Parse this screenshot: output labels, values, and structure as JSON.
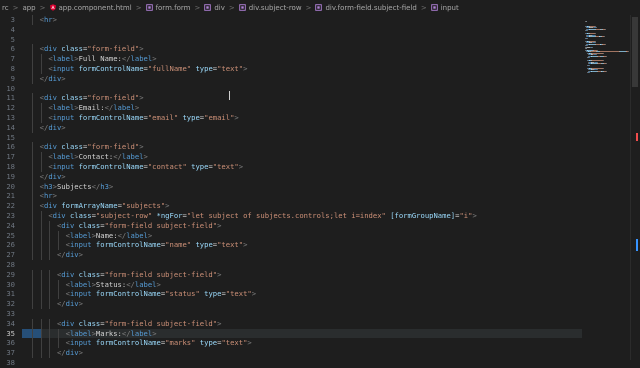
{
  "breadcrumb": {
    "items": [
      {
        "label": "rc",
        "icon": ""
      },
      {
        "label": "app",
        "icon": ""
      },
      {
        "label": "app.component.html",
        "icon": "angular-icon"
      },
      {
        "label": "form.form",
        "icon": "element-icon"
      },
      {
        "label": "div",
        "icon": "element-icon"
      },
      {
        "label": "div.subject-row",
        "icon": "element-icon"
      },
      {
        "label": "div.form-field.subject-field",
        "icon": "element-icon"
      },
      {
        "label": "input",
        "icon": "element-icon"
      }
    ],
    "separator": ">"
  },
  "editor": {
    "first_line_number": 3,
    "active_line": 35,
    "lines": [
      {
        "n": 3,
        "indent": 2,
        "tokens": [
          [
            "pun",
            "<"
          ],
          [
            "tag",
            "hr"
          ],
          [
            "pun",
            ">"
          ]
        ]
      },
      {
        "n": 4,
        "indent": 0,
        "tokens": []
      },
      {
        "n": 5,
        "indent": 0,
        "tokens": []
      },
      {
        "n": 6,
        "indent": 2,
        "tokens": [
          [
            "pun",
            "<"
          ],
          [
            "tag",
            "div"
          ],
          [
            "txt",
            " "
          ],
          [
            "attr",
            "class"
          ],
          [
            "txt",
            "="
          ],
          [
            "str",
            "\"form-field\""
          ],
          [
            "pun",
            ">"
          ]
        ]
      },
      {
        "n": 7,
        "indent": 4,
        "tokens": [
          [
            "pun",
            "<"
          ],
          [
            "tag",
            "label"
          ],
          [
            "pun",
            ">"
          ],
          [
            "txt",
            "Full Name:"
          ],
          [
            "pun",
            "</"
          ],
          [
            "tag",
            "label"
          ],
          [
            "pun",
            ">"
          ]
        ]
      },
      {
        "n": 8,
        "indent": 4,
        "tokens": [
          [
            "pun",
            "<"
          ],
          [
            "tag",
            "input"
          ],
          [
            "txt",
            " "
          ],
          [
            "attr",
            "formControlName"
          ],
          [
            "txt",
            "="
          ],
          [
            "str",
            "\"fullName\""
          ],
          [
            "txt",
            " "
          ],
          [
            "attr",
            "type"
          ],
          [
            "txt",
            "="
          ],
          [
            "str",
            "\"text\""
          ],
          [
            "pun",
            ">"
          ]
        ]
      },
      {
        "n": 9,
        "indent": 2,
        "tokens": [
          [
            "pun",
            "</"
          ],
          [
            "tag",
            "div"
          ],
          [
            "pun",
            ">"
          ]
        ]
      },
      {
        "n": 10,
        "indent": 0,
        "tokens": []
      },
      {
        "n": 11,
        "indent": 2,
        "tokens": [
          [
            "pun",
            "<"
          ],
          [
            "tag",
            "div"
          ],
          [
            "txt",
            " "
          ],
          [
            "attr",
            "class"
          ],
          [
            "txt",
            "="
          ],
          [
            "str",
            "\"form-field\""
          ],
          [
            "pun",
            ">"
          ]
        ]
      },
      {
        "n": 12,
        "indent": 4,
        "tokens": [
          [
            "pun",
            "<"
          ],
          [
            "tag",
            "label"
          ],
          [
            "pun",
            ">"
          ],
          [
            "txt",
            "Email:"
          ],
          [
            "pun",
            "</"
          ],
          [
            "tag",
            "label"
          ],
          [
            "pun",
            ">"
          ]
        ]
      },
      {
        "n": 13,
        "indent": 4,
        "tokens": [
          [
            "pun",
            "<"
          ],
          [
            "tag",
            "input"
          ],
          [
            "txt",
            " "
          ],
          [
            "attr",
            "formControlName"
          ],
          [
            "txt",
            "="
          ],
          [
            "str",
            "\"email\""
          ],
          [
            "txt",
            " "
          ],
          [
            "attr",
            "type"
          ],
          [
            "txt",
            "="
          ],
          [
            "str",
            "\"email\""
          ],
          [
            "pun",
            ">"
          ]
        ]
      },
      {
        "n": 14,
        "indent": 2,
        "tokens": [
          [
            "pun",
            "</"
          ],
          [
            "tag",
            "div"
          ],
          [
            "pun",
            ">"
          ]
        ]
      },
      {
        "n": 15,
        "indent": 0,
        "tokens": []
      },
      {
        "n": 16,
        "indent": 2,
        "tokens": [
          [
            "pun",
            "<"
          ],
          [
            "tag",
            "div"
          ],
          [
            "txt",
            " "
          ],
          [
            "attr",
            "class"
          ],
          [
            "txt",
            "="
          ],
          [
            "str",
            "\"form-field\""
          ],
          [
            "pun",
            ">"
          ]
        ]
      },
      {
        "n": 17,
        "indent": 4,
        "tokens": [
          [
            "pun",
            "<"
          ],
          [
            "tag",
            "label"
          ],
          [
            "pun",
            ">"
          ],
          [
            "txt",
            "Contact:"
          ],
          [
            "pun",
            "</"
          ],
          [
            "tag",
            "label"
          ],
          [
            "pun",
            ">"
          ]
        ]
      },
      {
        "n": 18,
        "indent": 4,
        "tokens": [
          [
            "pun",
            "<"
          ],
          [
            "tag",
            "input"
          ],
          [
            "txt",
            " "
          ],
          [
            "attr",
            "formControlName"
          ],
          [
            "txt",
            "="
          ],
          [
            "str",
            "\"contact\""
          ],
          [
            "txt",
            " "
          ],
          [
            "attr",
            "type"
          ],
          [
            "txt",
            "="
          ],
          [
            "str",
            "\"text\""
          ],
          [
            "pun",
            ">"
          ]
        ]
      },
      {
        "n": 19,
        "indent": 2,
        "tokens": [
          [
            "pun",
            "</"
          ],
          [
            "tag",
            "div"
          ],
          [
            "pun",
            ">"
          ]
        ]
      },
      {
        "n": 20,
        "indent": 2,
        "tokens": [
          [
            "pun",
            "<"
          ],
          [
            "tag",
            "h3"
          ],
          [
            "pun",
            ">"
          ],
          [
            "txt",
            "Subjects"
          ],
          [
            "pun",
            "</"
          ],
          [
            "tag",
            "h3"
          ],
          [
            "pun",
            ">"
          ]
        ]
      },
      {
        "n": 21,
        "indent": 2,
        "tokens": [
          [
            "pun",
            "<"
          ],
          [
            "tag",
            "hr"
          ],
          [
            "pun",
            ">"
          ]
        ]
      },
      {
        "n": 22,
        "indent": 2,
        "tokens": [
          [
            "pun",
            "<"
          ],
          [
            "tag",
            "div"
          ],
          [
            "txt",
            " "
          ],
          [
            "attr",
            "formArrayName"
          ],
          [
            "txt",
            "="
          ],
          [
            "str",
            "\"subjects\""
          ],
          [
            "pun",
            ">"
          ]
        ]
      },
      {
        "n": 23,
        "indent": 4,
        "tokens": [
          [
            "pun",
            "<"
          ],
          [
            "tag",
            "div"
          ],
          [
            "txt",
            " "
          ],
          [
            "attr",
            "class"
          ],
          [
            "txt",
            "="
          ],
          [
            "str",
            "\"subject-row\""
          ],
          [
            "txt",
            " "
          ],
          [
            "attr",
            "*ngFor"
          ],
          [
            "txt",
            "="
          ],
          [
            "str",
            "\"let subject of subjects.controls;let i=index\""
          ],
          [
            "txt",
            " "
          ],
          [
            "attr",
            "[formGroupName]"
          ],
          [
            "txt",
            "="
          ],
          [
            "str",
            "\"i\""
          ],
          [
            "pun",
            ">"
          ]
        ]
      },
      {
        "n": 24,
        "indent": 6,
        "tokens": [
          [
            "pun",
            "<"
          ],
          [
            "tag",
            "div"
          ],
          [
            "txt",
            " "
          ],
          [
            "attr",
            "class"
          ],
          [
            "txt",
            "="
          ],
          [
            "str",
            "\"form-field subject-field\""
          ],
          [
            "pun",
            ">"
          ]
        ]
      },
      {
        "n": 25,
        "indent": 8,
        "tokens": [
          [
            "pun",
            "<"
          ],
          [
            "tag",
            "label"
          ],
          [
            "pun",
            ">"
          ],
          [
            "txt",
            "Name:"
          ],
          [
            "pun",
            "</"
          ],
          [
            "tag",
            "label"
          ],
          [
            "pun",
            ">"
          ]
        ]
      },
      {
        "n": 26,
        "indent": 8,
        "tokens": [
          [
            "pun",
            "<"
          ],
          [
            "tag",
            "input"
          ],
          [
            "txt",
            " "
          ],
          [
            "attr",
            "formControlName"
          ],
          [
            "txt",
            "="
          ],
          [
            "str",
            "\"name\""
          ],
          [
            "txt",
            " "
          ],
          [
            "attr",
            "type"
          ],
          [
            "txt",
            "="
          ],
          [
            "str",
            "\"text\""
          ],
          [
            "pun",
            ">"
          ]
        ]
      },
      {
        "n": 27,
        "indent": 6,
        "tokens": [
          [
            "pun",
            "</"
          ],
          [
            "tag",
            "div"
          ],
          [
            "pun",
            ">"
          ]
        ]
      },
      {
        "n": 28,
        "indent": 0,
        "tokens": []
      },
      {
        "n": 29,
        "indent": 6,
        "tokens": [
          [
            "pun",
            "<"
          ],
          [
            "tag",
            "div"
          ],
          [
            "txt",
            " "
          ],
          [
            "attr",
            "class"
          ],
          [
            "txt",
            "="
          ],
          [
            "str",
            "\"form-field subject-field\""
          ],
          [
            "pun",
            ">"
          ]
        ]
      },
      {
        "n": 30,
        "indent": 8,
        "tokens": [
          [
            "pun",
            "<"
          ],
          [
            "tag",
            "label"
          ],
          [
            "pun",
            ">"
          ],
          [
            "txt",
            "Status:"
          ],
          [
            "pun",
            "</"
          ],
          [
            "tag",
            "label"
          ],
          [
            "pun",
            ">"
          ]
        ]
      },
      {
        "n": 31,
        "indent": 8,
        "tokens": [
          [
            "pun",
            "<"
          ],
          [
            "tag",
            "input"
          ],
          [
            "txt",
            " "
          ],
          [
            "attr",
            "formControlName"
          ],
          [
            "txt",
            "="
          ],
          [
            "str",
            "\"status\""
          ],
          [
            "txt",
            " "
          ],
          [
            "attr",
            "type"
          ],
          [
            "txt",
            "="
          ],
          [
            "str",
            "\"text\""
          ],
          [
            "pun",
            ">"
          ]
        ]
      },
      {
        "n": 32,
        "indent": 6,
        "tokens": [
          [
            "pun",
            "</"
          ],
          [
            "tag",
            "div"
          ],
          [
            "pun",
            ">"
          ]
        ]
      },
      {
        "n": 33,
        "indent": 0,
        "tokens": []
      },
      {
        "n": 34,
        "indent": 6,
        "tokens": [
          [
            "pun",
            "<"
          ],
          [
            "tag",
            "div"
          ],
          [
            "txt",
            " "
          ],
          [
            "attr",
            "class"
          ],
          [
            "txt",
            "="
          ],
          [
            "str",
            "\"form-field subject-field\""
          ],
          [
            "pun",
            ">"
          ]
        ]
      },
      {
        "n": 35,
        "indent": 8,
        "tokens": [
          [
            "pun",
            "<"
          ],
          [
            "tag",
            "label"
          ],
          [
            "pun",
            ">"
          ],
          [
            "txt",
            "Marks:"
          ],
          [
            "pun",
            "</"
          ],
          [
            "tag",
            "label"
          ],
          [
            "pun",
            ">"
          ]
        ]
      },
      {
        "n": 36,
        "indent": 8,
        "tokens": [
          [
            "pun",
            "<"
          ],
          [
            "tag",
            "input"
          ],
          [
            "txt",
            " "
          ],
          [
            "attr",
            "formControlName"
          ],
          [
            "txt",
            "="
          ],
          [
            "str",
            "\"marks\""
          ],
          [
            "txt",
            " "
          ],
          [
            "attr",
            "type"
          ],
          [
            "txt",
            "="
          ],
          [
            "str",
            "\"text\""
          ],
          [
            "pun",
            ">"
          ]
        ]
      },
      {
        "n": 37,
        "indent": 6,
        "tokens": [
          [
            "pun",
            "</"
          ],
          [
            "tag",
            "div"
          ],
          [
            "pun",
            ">"
          ]
        ]
      },
      {
        "n": 38,
        "indent": 0,
        "tokens": []
      }
    ]
  },
  "colors": {
    "background": "#1e1e1e",
    "tag": "#569cd6",
    "attribute": "#9cdcfe",
    "string": "#ce9178",
    "punctuation": "#808080",
    "text": "#d4d4d4",
    "line_number": "#6e7681",
    "selection": "#264f78",
    "scroll_marker_red": "#f14c4c",
    "scroll_marker_blue": "#3794ff"
  }
}
